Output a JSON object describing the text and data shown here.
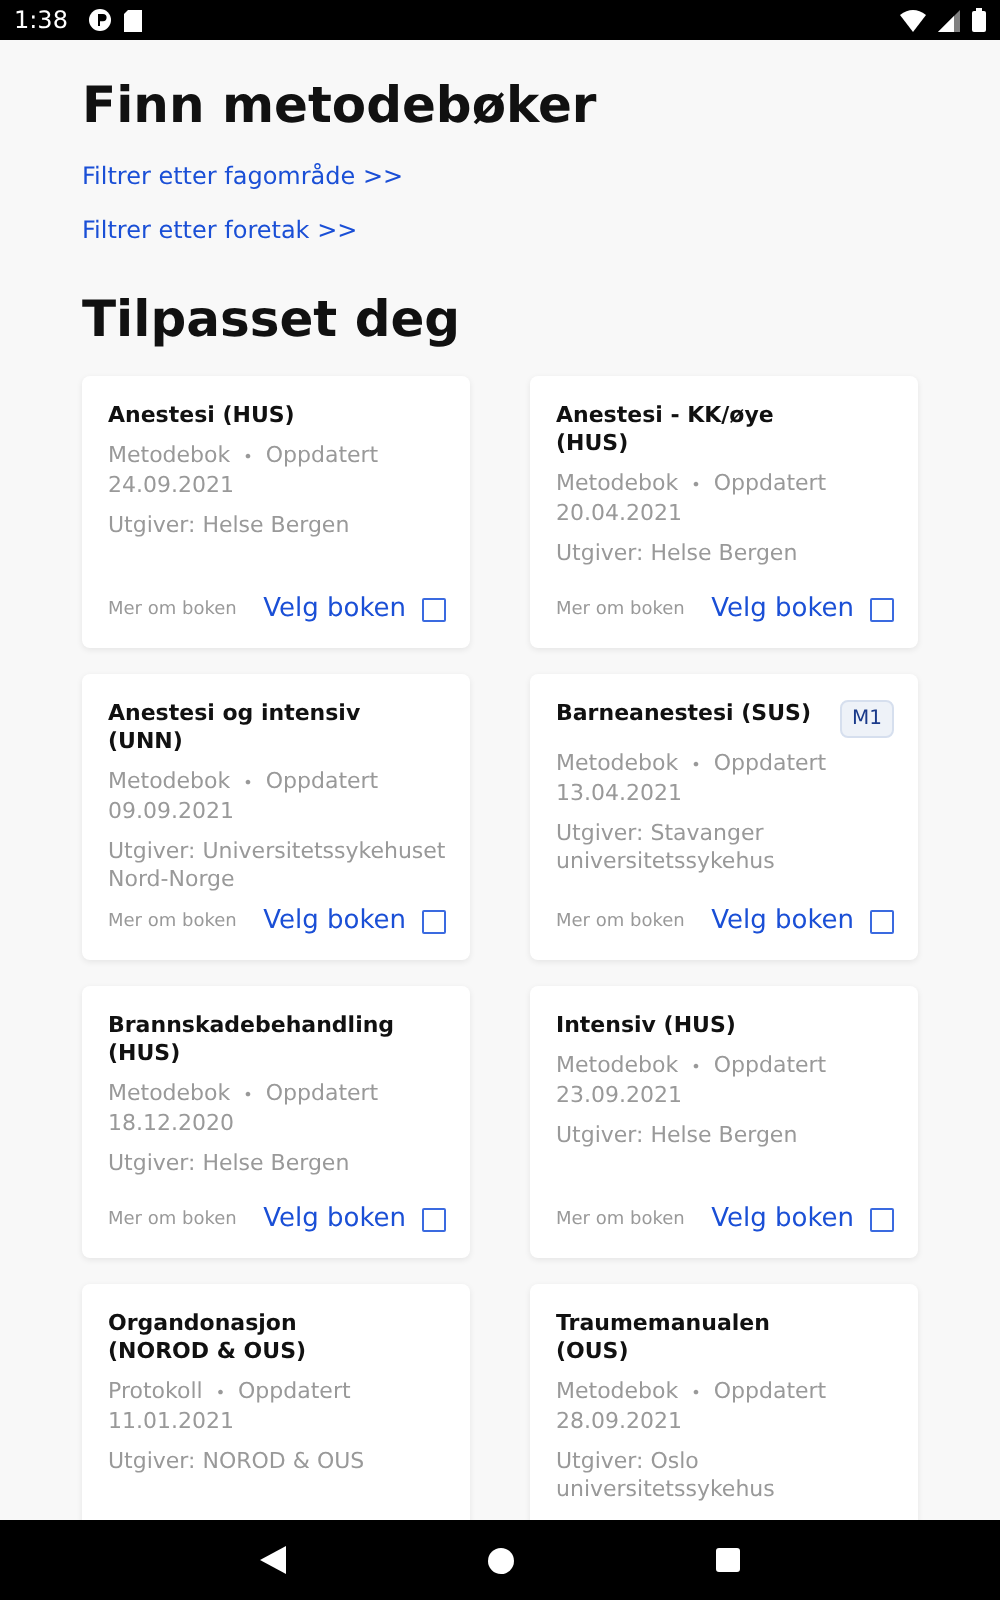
{
  "status_bar": {
    "time": "1:38"
  },
  "title": "Finn metodebøker",
  "filters": [
    "Filtrer etter fagområde >>",
    "Filtrer etter foretak >>"
  ],
  "section_title": "Tilpasset deg",
  "books": [
    {
      "title": "Anestesi (HUS)",
      "type": "Metodebok",
      "separator": "•",
      "updated": "Oppdatert",
      "date": "24.09.2021",
      "publisher": "Utgiver: Helse Bergen",
      "more": "Mer om boken",
      "select": "Velg boken",
      "checked": false
    },
    {
      "title": "Anestesi - KK/øye (HUS)",
      "type": "Metodebok",
      "separator": "•",
      "updated": "Oppdatert",
      "date": "20.04.2021",
      "publisher": "Utgiver: Helse Bergen",
      "more": "Mer om boken",
      "select": "Velg boken",
      "checked": false
    },
    {
      "title": "Anestesi og intensiv (UNN)",
      "type": "Metodebok",
      "separator": "•",
      "updated": "Oppdatert",
      "date": "09.09.2021",
      "publisher": "Utgiver: Universitetssykehuset Nord-Norge",
      "more": "Mer om boken",
      "select": "Velg boken",
      "checked": false
    },
    {
      "title": "Barneanestesi (SUS)",
      "badge": "M1",
      "type": "Metodebok",
      "separator": "•",
      "updated": "Oppdatert",
      "date": "13.04.2021",
      "publisher": "Utgiver: Stavanger universitetssykehus",
      "more": "Mer om boken",
      "select": "Velg boken",
      "checked": false
    },
    {
      "title": "Brannskadebehandling (HUS)",
      "type": "Metodebok",
      "separator": "•",
      "updated": "Oppdatert",
      "date": "18.12.2020",
      "publisher": "Utgiver: Helse Bergen",
      "more": "Mer om boken",
      "select": "Velg boken",
      "checked": false
    },
    {
      "title": "Intensiv (HUS)",
      "type": "Metodebok",
      "separator": "•",
      "updated": "Oppdatert",
      "date": "23.09.2021",
      "publisher": "Utgiver: Helse Bergen",
      "more": "Mer om boken",
      "select": "Velg boken",
      "checked": false
    },
    {
      "title": "Organdonasjon (NOROD & OUS)",
      "type": "Protokoll",
      "separator": "•",
      "updated": "Oppdatert",
      "date": "11.01.2021",
      "publisher": "Utgiver: NOROD & OUS"
    },
    {
      "title": "Traumemanualen (OUS)",
      "type": "Metodebok",
      "separator": "•",
      "updated": "Oppdatert",
      "date": "28.09.2021",
      "publisher": "Utgiver: Oslo universitetssykehus"
    }
  ]
}
